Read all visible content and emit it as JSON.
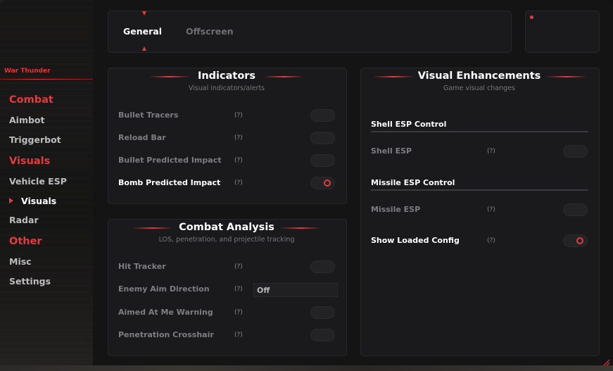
{
  "app": {
    "title": "War Thunder"
  },
  "sidebar": {
    "categories": [
      {
        "label": "Combat",
        "items": [
          "Aimbot",
          "Triggerbot"
        ]
      },
      {
        "label": "Visuals",
        "items": [
          "Vehicle ESP",
          "Visuals",
          "Radar"
        ]
      },
      {
        "label": "Other",
        "items": [
          "Misc",
          "Settings"
        ]
      }
    ],
    "active_item": "Visuals"
  },
  "tabs": [
    {
      "label": "General",
      "active": true
    },
    {
      "label": "Offscreen",
      "active": false
    }
  ],
  "indicators": {
    "title": "Indicators",
    "subtitle": "Visual indicators/alerts",
    "options": [
      {
        "label": "Bullet Tracers",
        "help": "(?)",
        "enabled": false
      },
      {
        "label": "Reload Bar",
        "help": "(?)",
        "enabled": false
      },
      {
        "label": "Bullet Predicted Impact",
        "help": "(?)",
        "enabled": false
      },
      {
        "label": "Bomb Predicted Impact",
        "help": "(?)",
        "enabled": true
      }
    ]
  },
  "combat_analysis": {
    "title": "Combat Analysis",
    "subtitle": "LOS, penetration, and projectile tracking",
    "options": [
      {
        "label": "Hit Tracker",
        "help": "(?)",
        "enabled": false
      },
      {
        "label": "Enemy Aim Direction",
        "help": "(?)",
        "value": "Off"
      },
      {
        "label": "Aimed At Me Warning",
        "help": "(?)",
        "enabled": false
      },
      {
        "label": "Penetration Crosshair",
        "help": "(?)",
        "enabled": false
      }
    ]
  },
  "visual_enhancements": {
    "title": "Visual Enhancements",
    "subtitle": "Game visual changes",
    "groups": [
      {
        "heading": "Shell ESP Control",
        "option": {
          "label": "Shell ESP",
          "help": "(?)",
          "enabled": false
        }
      },
      {
        "heading": "Missile ESP Control",
        "option": {
          "label": "Missile ESP",
          "help": "(?)",
          "enabled": false
        }
      }
    ],
    "extra": {
      "label": "Show Loaded Config",
      "help": "(?)",
      "enabled": true
    }
  },
  "colors": {
    "accent": "#e33b40",
    "panel": "#1a1a1c",
    "background": "#141415"
  }
}
